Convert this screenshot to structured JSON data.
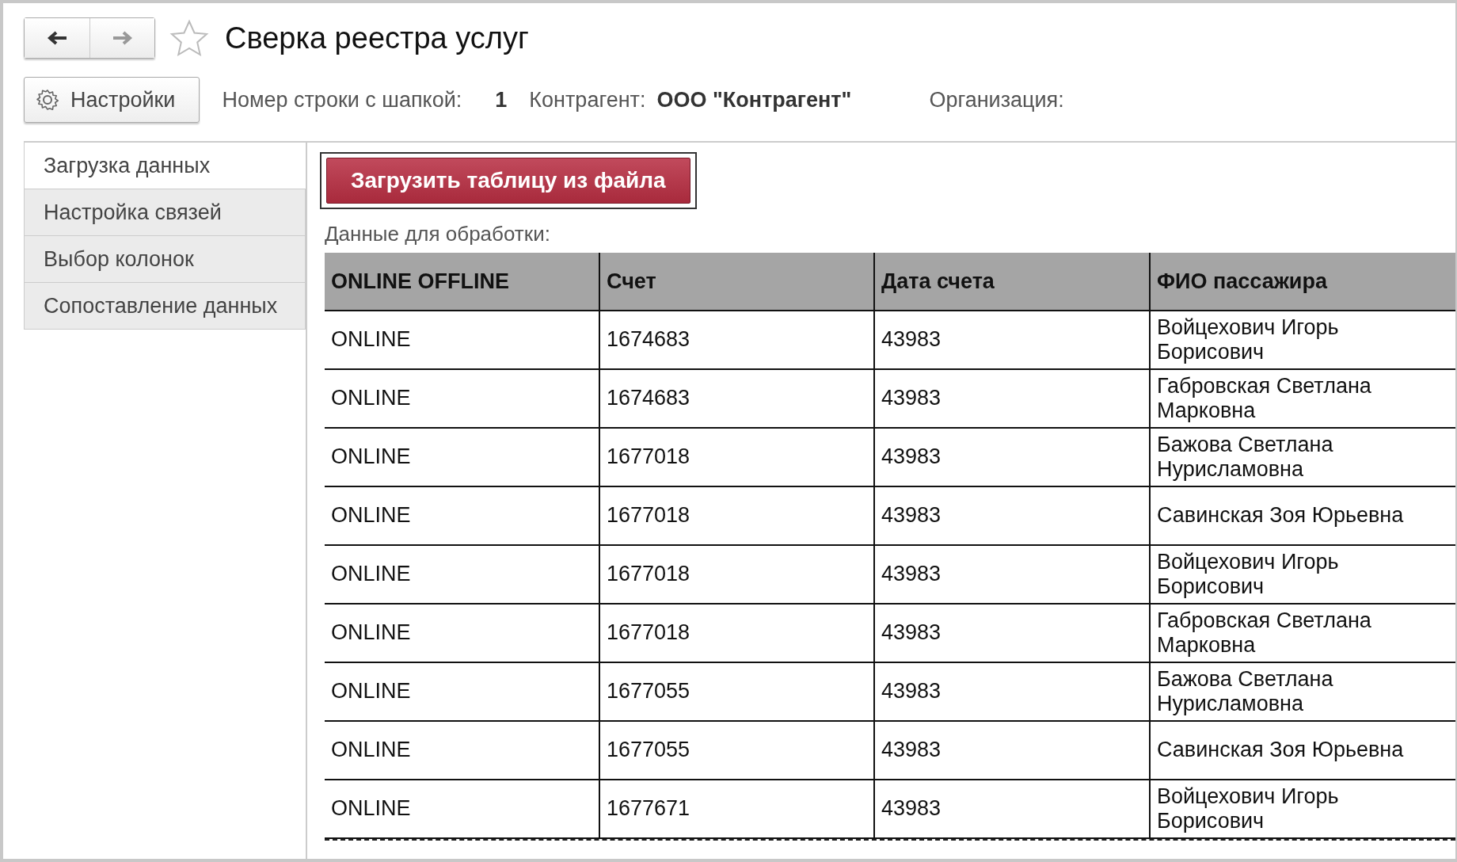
{
  "window": {
    "title": "Сверка реестра услуг",
    "favorite": false
  },
  "toolbar": {
    "settings_button": "Настройки",
    "fields": [
      {
        "label": "Номер строки с шапкой:",
        "value": "1"
      },
      {
        "label": "Контрагент:",
        "value": "ООО \"Контрагент\""
      },
      {
        "label": "Организация:"
      }
    ]
  },
  "tabs": [
    {
      "label": "Загрузка данных",
      "selected": true
    },
    {
      "label": "Настройка связей",
      "selected": false
    },
    {
      "label": "Выбор колонок",
      "selected": false
    },
    {
      "label": "Сопоставление данных",
      "selected": false
    }
  ],
  "load_button": "Загрузить таблицу из файла",
  "table": {
    "caption": "Данные для обработки:",
    "columns": [
      "ONLINE OFFLINE",
      "Счет",
      "Дата счета",
      "ФИО пассажира"
    ],
    "rows": [
      [
        "ONLINE",
        "1674683",
        "43983",
        "Войцехович Игорь Борисович"
      ],
      [
        "ONLINE",
        "1674683",
        "43983",
        "Габровская Светлана Марковна"
      ],
      [
        "ONLINE",
        "1677018",
        "43983",
        "Бажова Светлана Нурисламовна"
      ],
      [
        "ONLINE",
        "1677018",
        "43983",
        "Савинская Зоя Юрьевна"
      ],
      [
        "ONLINE",
        "1677018",
        "43983",
        "Войцехович Игорь Борисович"
      ],
      [
        "ONLINE",
        "1677018",
        "43983",
        "Габровская Светлана Марковна"
      ],
      [
        "ONLINE",
        "1677055",
        "43983",
        "Бажова Светлана Нурисламовна"
      ],
      [
        "ONLINE",
        "1677055",
        "43983",
        "Савинская Зоя Юрьевна"
      ],
      [
        "ONLINE",
        "1677671",
        "43983",
        "Войцехович Игорь Борисович"
      ]
    ]
  }
}
